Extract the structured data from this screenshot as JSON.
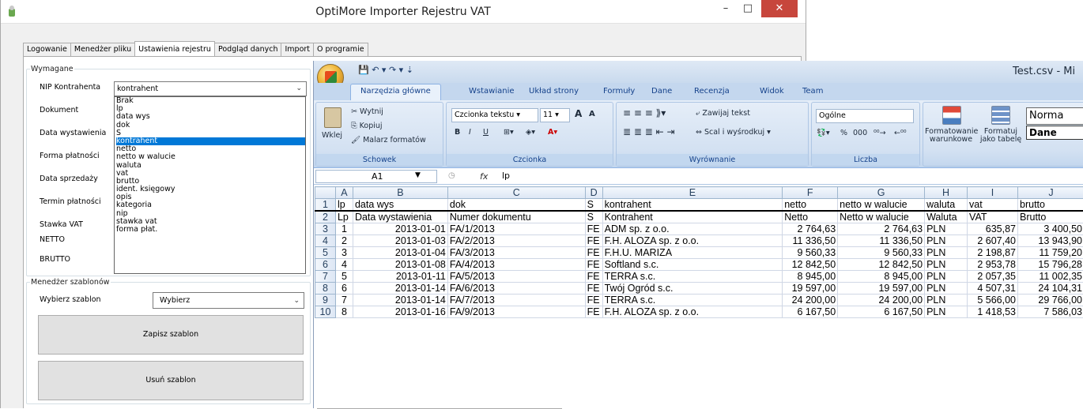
{
  "window": {
    "title": "OptiMore Importer Rejestru VAT",
    "minimize": "–",
    "maximize": "□",
    "close": "✕"
  },
  "tabs": [
    "Logowanie",
    "Menedżer pliku",
    "Ustawienia rejestru",
    "Podgląd danych",
    "Import",
    "O programie"
  ],
  "required": {
    "legend": "Wymagane",
    "fields": [
      {
        "label": "NIP Kontrahenta",
        "value": "kontrahent"
      },
      {
        "label": "Dokument",
        "value": ""
      },
      {
        "label": "Data wystawienia",
        "value": ""
      },
      {
        "label": "Forma płatności",
        "value": ""
      },
      {
        "label": "Data sprzedaży",
        "value": ""
      },
      {
        "label": "Termin płatności",
        "value": ""
      },
      {
        "label": "Stawka VAT",
        "value": ""
      },
      {
        "label": "NETTO",
        "value": ""
      },
      {
        "label": "BRUTTO",
        "value": ""
      }
    ]
  },
  "dropdown": {
    "items": [
      "Brak",
      "lp",
      "data wys",
      "dok",
      "S",
      "kontrahent",
      "netto",
      "netto w walucie",
      "waluta",
      "vat",
      "brutto",
      "ident. księgowy",
      "opis",
      "kategoria",
      "nip",
      "stawka vat",
      "forma płat."
    ],
    "selected": "kontrahent"
  },
  "templates": {
    "legend": "Menedżer szablonów",
    "choose_label": "Wybierz szablon",
    "choose_value": "Wybierz",
    "save_button": "Zapisz szablon",
    "delete_button": "Usuń szablon"
  },
  "excel": {
    "title": "Test.csv - Mi",
    "ribbon_tabs": [
      "Narzędzia główne",
      "Wstawianie",
      "Układ strony",
      "Formuły",
      "Dane",
      "Recenzja",
      "Widok",
      "Team"
    ],
    "active_tab": "Narzędzia główne",
    "clipboard": {
      "paste": "Wklej",
      "cut": "Wytnij",
      "copy": "Kopiuj",
      "painter": "Malarz formatów",
      "group": "Schowek"
    },
    "font": {
      "name": "Czcionka tekstu",
      "size": "11",
      "group": "Czcionka",
      "bold": "B",
      "italic": "I",
      "underline": "U",
      "grow": "A",
      "shrink": "A"
    },
    "alignment": {
      "wrap": "Zawijaj tekst",
      "merge": "Scal i wyśrodkuj",
      "group": "Wyrównanie"
    },
    "number": {
      "format": "Ogólne",
      "percent": "%",
      "thousands": "000",
      "inc": "⁰⁰→",
      "dec": "←⁰⁰",
      "group": "Liczba"
    },
    "styles": {
      "conditional": "Formatowanie warunkowe",
      "as_table": "Formatuj jako tabelę",
      "normal": "Norma",
      "dane": "Dane"
    },
    "name_box": "A1",
    "formula": "lp",
    "col_headers": [
      "A",
      "B",
      "C",
      "D",
      "E",
      "F",
      "G",
      "H",
      "I",
      "J"
    ],
    "rows": [
      [
        "1",
        "lp",
        "data wys",
        "dok",
        "S",
        "kontrahent",
        "netto",
        "netto w walucie",
        "waluta",
        "vat",
        "brutto"
      ],
      [
        "2",
        "Lp",
        "Data wystawienia",
        "Numer dokumentu",
        "S",
        "Kontrahent",
        "Netto",
        "Netto w walucie",
        "Waluta",
        "VAT",
        "Brutto"
      ],
      [
        "3",
        "1",
        "2013-01-01",
        "FA/1/2013",
        "FE",
        "ADM sp. z o.o.",
        "2 764,63",
        "2 764,63",
        "PLN",
        "635,87",
        "3 400,50"
      ],
      [
        "4",
        "2",
        "2013-01-03",
        "FA/2/2013",
        "FE",
        "F.H. ALOZA sp. z o.o.",
        "11 336,50",
        "11 336,50",
        "PLN",
        "2 607,40",
        "13 943,90"
      ],
      [
        "5",
        "3",
        "2013-01-04",
        "FA/3/2013",
        "FE",
        "F.H.U. MARIZA",
        "9 560,33",
        "9 560,33",
        "PLN",
        "2 198,87",
        "11 759,20"
      ],
      [
        "6",
        "4",
        "2013-01-08",
        "FA/4/2013",
        "FE",
        "Softland s.c.",
        "12 842,50",
        "12 842,50",
        "PLN",
        "2 953,78",
        "15 796,28"
      ],
      [
        "7",
        "5",
        "2013-01-11",
        "FA/5/2013",
        "FE",
        "TERRA s.c.",
        "8 945,00",
        "8 945,00",
        "PLN",
        "2 057,35",
        "11 002,35"
      ],
      [
        "8",
        "6",
        "2013-01-14",
        "FA/6/2013",
        "FE",
        "Twój Ogród s.c.",
        "19 597,00",
        "19 597,00",
        "PLN",
        "4 507,31",
        "24 104,31"
      ],
      [
        "9",
        "7",
        "2013-01-14",
        "FA/7/2013",
        "FE",
        "TERRA s.c.",
        "24 200,00",
        "24 200,00",
        "PLN",
        "5 566,00",
        "29 766,00"
      ],
      [
        "10",
        "8",
        "2013-01-16",
        "FA/9/2013",
        "FE",
        "F.H. ALOZA sp. z o.o.",
        "6 167,50",
        "6 167,50",
        "PLN",
        "1 418,53",
        "7 586,03"
      ]
    ]
  }
}
